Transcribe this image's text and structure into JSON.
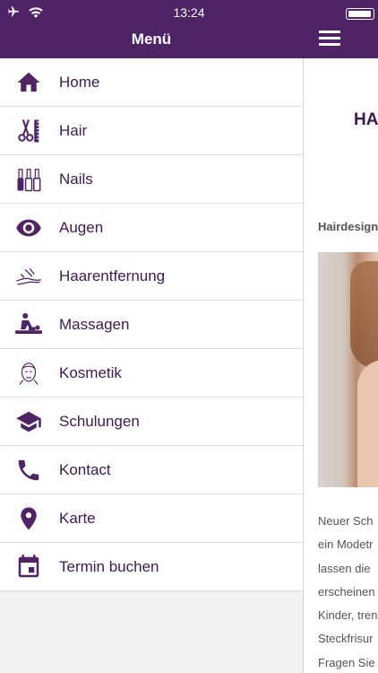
{
  "status_bar": {
    "time": "13:24"
  },
  "header": {
    "title": "Menü"
  },
  "menu": {
    "items": [
      {
        "label": "Home",
        "icon": "home-icon"
      },
      {
        "label": "Hair",
        "icon": "scissors-comb-icon"
      },
      {
        "label": "Nails",
        "icon": "nail-polish-icon"
      },
      {
        "label": "Augen",
        "icon": "eye-icon"
      },
      {
        "label": "Haarentfernung",
        "icon": "leg-wax-icon"
      },
      {
        "label": "Massagen",
        "icon": "massage-icon"
      },
      {
        "label": "Kosmetik",
        "icon": "face-icon"
      },
      {
        "label": "Schulungen",
        "icon": "graduation-cap-icon"
      },
      {
        "label": "Kontact",
        "icon": "phone-icon"
      },
      {
        "label": "Karte",
        "icon": "map-pin-icon"
      },
      {
        "label": "Termin buchen",
        "icon": "calendar-icon"
      }
    ]
  },
  "content": {
    "title": "HA",
    "section_title": "Hairdesign",
    "paragraph_lines": [
      "Neuer Sch",
      "ein Modetr",
      "lassen die",
      "erscheinen",
      "Kinder, tren",
      "Steckfrisur",
      "Fragen Sie"
    ]
  },
  "colors": {
    "brand": "#4e2466",
    "menu_text": "#3d1a52"
  }
}
